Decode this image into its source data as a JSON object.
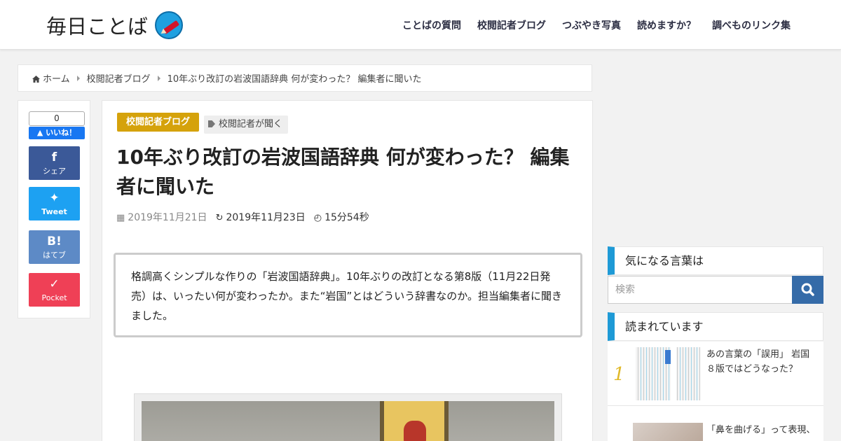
{
  "header": {
    "logo_text": "毎日ことば",
    "nav": [
      "ことばの質問",
      "校閲記者ブログ",
      "つぶやき写真",
      "読めますか？",
      "調べものリンク集"
    ]
  },
  "breadcrumb": {
    "home": "ホーム",
    "category": "校閲記者ブログ",
    "current": "10年ぶり改訂の岩波国語辞典 何が変わった？ 編集者に聞いた"
  },
  "share": {
    "like_count": "0",
    "like_label": "いいね！",
    "facebook": "シェア",
    "twitter": "Tweet",
    "hatena_glyph": "B!",
    "hatena": "はてブ",
    "pocket": "Pocket"
  },
  "article": {
    "category": "校閲記者ブログ",
    "tag": "校閲記者が聞く",
    "title": "10年ぶり改訂の岩波国語辞典 何が変わった？ 編集者に聞いた",
    "published": "2019年11月21日",
    "updated": "2019年11月23日",
    "read_time": "15分54秒",
    "lead": "格調高くシンプルな作りの「岩波国語辞典」。10年ぶりの改訂となる第8版（11月22日発売）は、いったい何が変わったか。また“岩国”とはどういう辞書なのか。担当編集者に聞きました。"
  },
  "sidebar": {
    "widget1_title": "気になる言葉は",
    "search_placeholder": "検索",
    "widget2_title": "読まれています",
    "popular": [
      {
        "rank": "1",
        "title": "あの言葉の「誤用」 岩国８版ではどうなった？"
      },
      {
        "rank": "",
        "title": "「鼻を曲げる」って表現、"
      }
    ]
  },
  "colors": {
    "category_badge": "#d5a20b",
    "widget_accent": "#1e9ad6",
    "search_button": "#356ba8",
    "facebook": "#3b5998",
    "twitter": "#1da1f2",
    "hatena": "#5d8ac6",
    "pocket": "#ef4056"
  }
}
